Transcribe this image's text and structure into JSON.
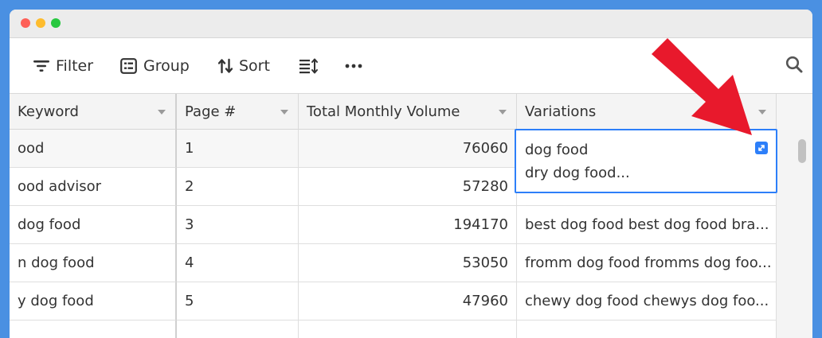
{
  "toolbar": {
    "filter_label": "Filter",
    "group_label": "Group",
    "sort_label": "Sort"
  },
  "columns": [
    {
      "label": "Keyword"
    },
    {
      "label": "Page #"
    },
    {
      "label": "Total Monthly Volume"
    },
    {
      "label": "Variations"
    }
  ],
  "rows": [
    {
      "keyword": "ood",
      "page": "1",
      "volume": "76060",
      "variations": ""
    },
    {
      "keyword": "ood advisor",
      "page": "2",
      "volume": "57280",
      "variations": ""
    },
    {
      "keyword": "dog food",
      "page": "3",
      "volume": "194170",
      "variations": "best dog food best dog food bra..."
    },
    {
      "keyword": "n dog food",
      "page": "4",
      "volume": "53050",
      "variations": "fromm dog food fromms dog foo..."
    },
    {
      "keyword": "y dog food",
      "page": "5",
      "volume": "47960",
      "variations": "chewy dog food chewys dog foo..."
    }
  ],
  "expanded_cell": {
    "line1": "dog food",
    "line2": "dry dog food..."
  },
  "colors": {
    "accent": "#2d7ff9",
    "annotation_arrow": "#e8192c",
    "frame": "#4a90e2"
  }
}
